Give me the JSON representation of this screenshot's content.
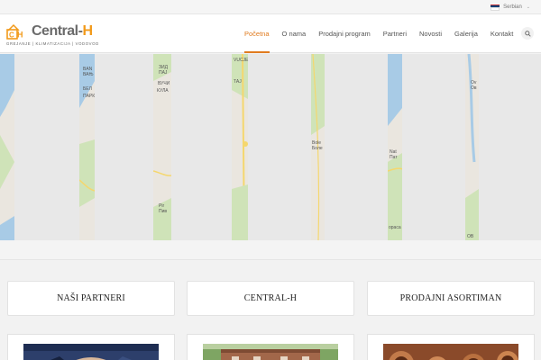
{
  "language": {
    "label": "Serbian",
    "flag": "serbia-flag",
    "chevron": "chevron-down-icon"
  },
  "logo": {
    "name_left": "Central-",
    "name_accent": "H",
    "mark": "CH",
    "tagline": "GREJANJE | KLIMATIZACIJA | VODOVOD"
  },
  "nav": {
    "items": [
      {
        "label": "Početna",
        "active": true
      },
      {
        "label": "O nama"
      },
      {
        "label": "Prodajni program"
      },
      {
        "label": "Partneri"
      },
      {
        "label": "Novosti"
      },
      {
        "label": "Galerija"
      },
      {
        "label": "Kontakt"
      }
    ],
    "search_icon": "search-icon"
  },
  "map": {
    "labels": [
      "BAN",
      "ВАЊ",
      "ЗИД",
      "ПАЈ",
      "ВУЧИ",
      "VUCJE",
      "ТАЈ",
      "БЕЛ",
      "КУЛА",
      "ПАРК",
      "Pir",
      "Пив",
      "Bole",
      "Боле",
      "Nat",
      "Пат",
      "Ov",
      "Ов",
      "opaca",
      "OB"
    ],
    "colors": {
      "land": "#eae6df",
      "green": "#cfe3b8",
      "water": "#a8cbe6",
      "road": "#f5d76e",
      "mask": "#e8e8e8"
    }
  },
  "cards": [
    {
      "title": "NAŠI PARTNERI"
    },
    {
      "title": "CENTRAL-H"
    },
    {
      "title": "PRODAJNI ASORTIMAN"
    }
  ],
  "colors": {
    "accent": "#e07b1f",
    "logo_orange": "#f29a1a"
  }
}
